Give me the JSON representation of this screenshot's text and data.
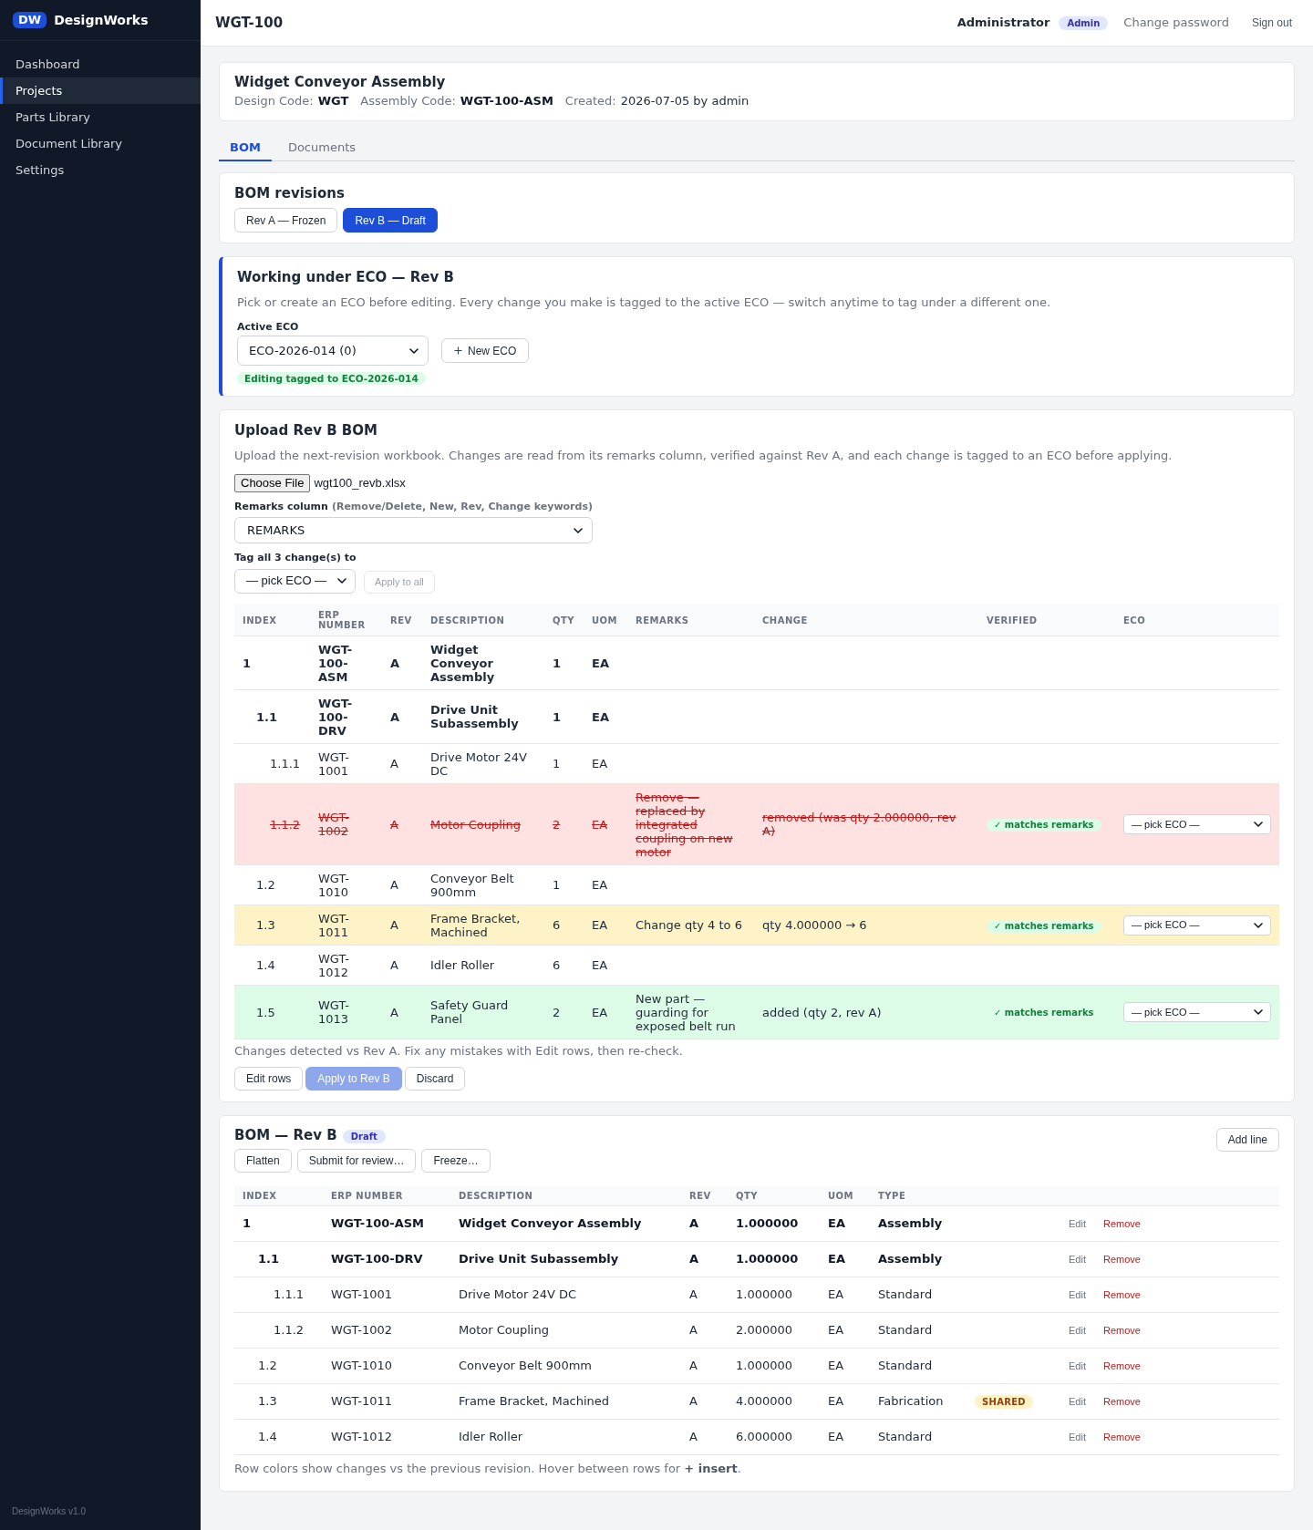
{
  "sidebar": {
    "logo": "DW",
    "brand": "DesignWorks",
    "items": [
      {
        "label": "Dashboard",
        "selected": false
      },
      {
        "label": "Projects",
        "selected": true
      },
      {
        "label": "Parts Library",
        "selected": false
      },
      {
        "label": "Document Library",
        "selected": false
      },
      {
        "label": "Settings",
        "selected": false
      }
    ],
    "footer": "DesignWorks v1.0"
  },
  "header": {
    "title": "WGT-100",
    "user": "Administrator",
    "role": "Admin",
    "change_password": "Change password",
    "sign_out": "Sign out"
  },
  "project": {
    "title": "Widget Conveyor Assembly",
    "meta": [
      {
        "label": "Design Code:",
        "value": "WGT",
        "bold": true
      },
      {
        "label": "Assembly Code:",
        "value": "WGT-100-ASM",
        "bold": true
      },
      {
        "label": "Created:",
        "value": "2026-07-05 by admin",
        "bold": false
      }
    ]
  },
  "tabs": [
    {
      "label": "BOM",
      "selected": true
    },
    {
      "label": "Documents",
      "selected": false
    }
  ],
  "revisions": {
    "title": "BOM revisions",
    "items": [
      {
        "label": "Rev A — Frozen",
        "selected": false
      },
      {
        "label": "Rev B — Draft",
        "selected": true
      }
    ]
  },
  "eco": {
    "title": "Working under ECO — Rev B",
    "description": "Pick or create an ECO before editing. Every change you make is tagged to the active ECO — switch anytime to tag under a different one.",
    "field_label": "Active ECO",
    "active_eco": "ECO-2026-014 (0)",
    "new_button": "New ECO",
    "status": "Editing tagged to ECO-2026-014"
  },
  "upload": {
    "title": "Upload Rev B BOM",
    "description": "Upload the next-revision workbook. Changes are read from its remarks column, verified against Rev A, and each change is tagged to an ECO before applying.",
    "file_button": "Choose File",
    "file_name": "wgt100_revb.xlsx",
    "remarks_label": "Remarks column",
    "remarks_hint": "(Remove/Delete, New, Rev, Change keywords)",
    "remarks_column": "REMARKS",
    "tag_label": "Tag all 3 change(s) to",
    "tag_eco": "— pick ECO —",
    "apply_all": {
      "label": "Apply to all",
      "disabled": true
    },
    "columns": [
      "INDEX",
      "ERP NUMBER",
      "REV",
      "DESCRIPTION",
      "QTY",
      "UOM",
      "REMARKS",
      "CHANGE",
      "VERIFIED",
      "ECO"
    ],
    "rows": [
      {
        "index": "1",
        "erp_number": "WGT-100-ASM",
        "rev": "A",
        "description": "Widget Conveyor Assembly",
        "qty": "1",
        "uom": "EA",
        "kind": "unchanged",
        "children": [
          {
            "index": "1.1",
            "erp_number": "WGT-100-DRV",
            "rev": "A",
            "description": "Drive Unit Subassembly",
            "qty": "1",
            "uom": "EA",
            "kind": "unchanged",
            "children": [
              {
                "index": "1.1.1",
                "erp_number": "WGT-1001",
                "rev": "A",
                "description": "Drive Motor 24V DC",
                "qty": "1",
                "uom": "EA",
                "kind": "unchanged"
              },
              {
                "index": "1.1.2",
                "erp_number": "WGT-1002",
                "rev": "A",
                "description": "Motor Coupling",
                "qty": "2",
                "uom": "EA",
                "kind": "removed",
                "remarks": "Remove — replaced by integrated coupling on new motor",
                "change": "removed (was qty 2.000000, rev A)",
                "verified": "✓ matches remarks",
                "eco": "— pick ECO —"
              }
            ]
          },
          {
            "index": "1.2",
            "erp_number": "WGT-1010",
            "rev": "A",
            "description": "Conveyor Belt 900mm",
            "qty": "1",
            "uom": "EA",
            "kind": "unchanged"
          },
          {
            "index": "1.3",
            "erp_number": "WGT-1011",
            "rev": "A",
            "description": "Frame Bracket, Machined",
            "qty": "6",
            "uom": "EA",
            "kind": "changed",
            "remarks": "Change qty 4 to 6",
            "change": "qty 4.000000 → 6",
            "verified": "✓ matches remarks",
            "eco": "— pick ECO —"
          },
          {
            "index": "1.4",
            "erp_number": "WGT-1012",
            "rev": "A",
            "description": "Idler Roller",
            "qty": "6",
            "uom": "EA",
            "kind": "unchanged"
          },
          {
            "index": "1.5",
            "erp_number": "WGT-1013",
            "rev": "A",
            "description": "Safety Guard Panel",
            "qty": "2",
            "uom": "EA",
            "kind": "added",
            "remarks": "New part — guarding for exposed belt run",
            "change": "added (qty 2, rev A)",
            "verified": "✓ matches remarks",
            "eco": "— pick ECO —"
          }
        ]
      }
    ],
    "note": "Changes detected vs Rev A. Fix any mistakes with Edit rows, then re-check.",
    "actions": [
      {
        "label": "Edit rows",
        "kind": "secondary",
        "disabled": false
      },
      {
        "label": "Apply to Rev B",
        "kind": "primary",
        "disabled": true
      },
      {
        "label": "Discard",
        "kind": "secondary",
        "disabled": false
      }
    ]
  },
  "bom": {
    "title": "BOM — Rev B",
    "badge": "Draft",
    "add_button": "Add line",
    "actions": [
      "Flatten",
      "Submit for review…",
      "Freeze…"
    ],
    "columns": [
      "INDEX",
      "ERP NUMBER",
      "DESCRIPTION",
      "REV",
      "QTY",
      "UOM",
      "TYPE"
    ],
    "rows": [
      {
        "index": "1",
        "erp_number": "WGT-100-ASM",
        "description": "Widget Conveyor Assembly",
        "rev": "A",
        "qty": "1.000000",
        "uom": "EA",
        "type": "Assembly",
        "actions": [
          {
            "label": "Edit",
            "kind": "edit"
          },
          {
            "label": "Remove",
            "kind": "remove"
          }
        ],
        "children": [
          {
            "index": "1.1",
            "erp_number": "WGT-100-DRV",
            "description": "Drive Unit Subassembly",
            "rev": "A",
            "qty": "1.000000",
            "uom": "EA",
            "type": "Assembly",
            "actions": [
              {
                "label": "Edit",
                "kind": "edit"
              },
              {
                "label": "Remove",
                "kind": "remove"
              }
            ],
            "children": [
              {
                "index": "1.1.1",
                "erp_number": "WGT-1001",
                "description": "Drive Motor 24V DC",
                "rev": "A",
                "qty": "1.000000",
                "uom": "EA",
                "type": "Standard",
                "actions": [
                  {
                    "label": "Edit",
                    "kind": "edit"
                  },
                  {
                    "label": "Remove",
                    "kind": "remove"
                  }
                ]
              },
              {
                "index": "1.1.2",
                "erp_number": "WGT-1002",
                "description": "Motor Coupling",
                "rev": "A",
                "qty": "2.000000",
                "uom": "EA",
                "type": "Standard",
                "actions": [
                  {
                    "label": "Edit",
                    "kind": "edit"
                  },
                  {
                    "label": "Remove",
                    "kind": "remove"
                  }
                ]
              }
            ]
          },
          {
            "index": "1.2",
            "erp_number": "WGT-1010",
            "description": "Conveyor Belt 900mm",
            "rev": "A",
            "qty": "1.000000",
            "uom": "EA",
            "type": "Standard",
            "actions": [
              {
                "label": "Edit",
                "kind": "edit"
              },
              {
                "label": "Remove",
                "kind": "remove"
              }
            ]
          },
          {
            "index": "1.3",
            "erp_number": "WGT-1011",
            "description": "Frame Bracket, Machined",
            "rev": "A",
            "qty": "4.000000",
            "uom": "EA",
            "type": "Fabrication",
            "badge": "SHARED",
            "actions": [
              {
                "label": "Edit",
                "kind": "edit"
              },
              {
                "label": "Remove",
                "kind": "remove"
              }
            ]
          },
          {
            "index": "1.4",
            "erp_number": "WGT-1012",
            "description": "Idler Roller",
            "rev": "A",
            "qty": "6.000000",
            "uom": "EA",
            "type": "Standard",
            "actions": [
              {
                "label": "Edit",
                "kind": "edit"
              },
              {
                "label": "Remove",
                "kind": "remove"
              }
            ]
          }
        ]
      }
    ],
    "footnote": "Row colors show changes vs the previous revision. Hover between rows for **+ insert**."
  }
}
